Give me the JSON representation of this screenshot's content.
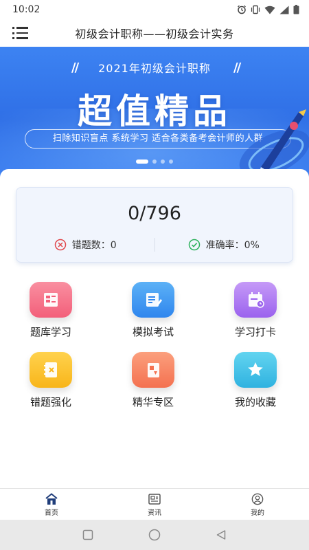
{
  "status_bar": {
    "time": "10:02",
    "icons": [
      "alarm-icon",
      "vibrate-icon",
      "wifi-icon",
      "signal-icon",
      "battery-icon"
    ]
  },
  "header": {
    "title": "初级会计职称——初级会计实务",
    "menu_icon": "list-menu-icon"
  },
  "banner": {
    "subtitle": "2021年初级会计职称",
    "title": "超值精品",
    "tagline": "扫除知识盲点  系统学习  适合各类备考会计师的人群",
    "slides_count": 4,
    "active_slide": 0
  },
  "stats": {
    "score": "0/796",
    "wrong_label": "错题数：",
    "wrong_value": "0",
    "accuracy_label": "准确率：",
    "accuracy_value": "0%"
  },
  "features": [
    {
      "label": "题库学习",
      "icon": "question-bank-icon",
      "color_top": "#f98fa0",
      "color_bottom": "#f35f7a"
    },
    {
      "label": "模拟考试",
      "icon": "mock-exam-icon",
      "color_top": "#5cb1f6",
      "color_bottom": "#2f86ee"
    },
    {
      "label": "学习打卡",
      "icon": "calendar-checkin-icon",
      "color_top": "#c59af7",
      "color_bottom": "#9b62ee"
    },
    {
      "label": "错题强化",
      "icon": "wrong-notebook-icon",
      "color_top": "#ffd24e",
      "color_bottom": "#f8b51a"
    },
    {
      "label": "精华专区",
      "icon": "essence-card-icon",
      "color_top": "#fb9f7d",
      "color_bottom": "#f47150"
    },
    {
      "label": "我的收藏",
      "icon": "star-favorite-icon",
      "color_top": "#62d4f0",
      "color_bottom": "#2fb2e0"
    }
  ],
  "tabs": [
    {
      "label": "首页",
      "icon": "home-icon",
      "active": true
    },
    {
      "label": "资讯",
      "icon": "news-icon",
      "active": false
    },
    {
      "label": "我的",
      "icon": "profile-icon",
      "active": false
    }
  ],
  "colors": {
    "accent": "#2f6fe6",
    "error_red": "#e0474c",
    "success_green": "#2eb15c"
  }
}
